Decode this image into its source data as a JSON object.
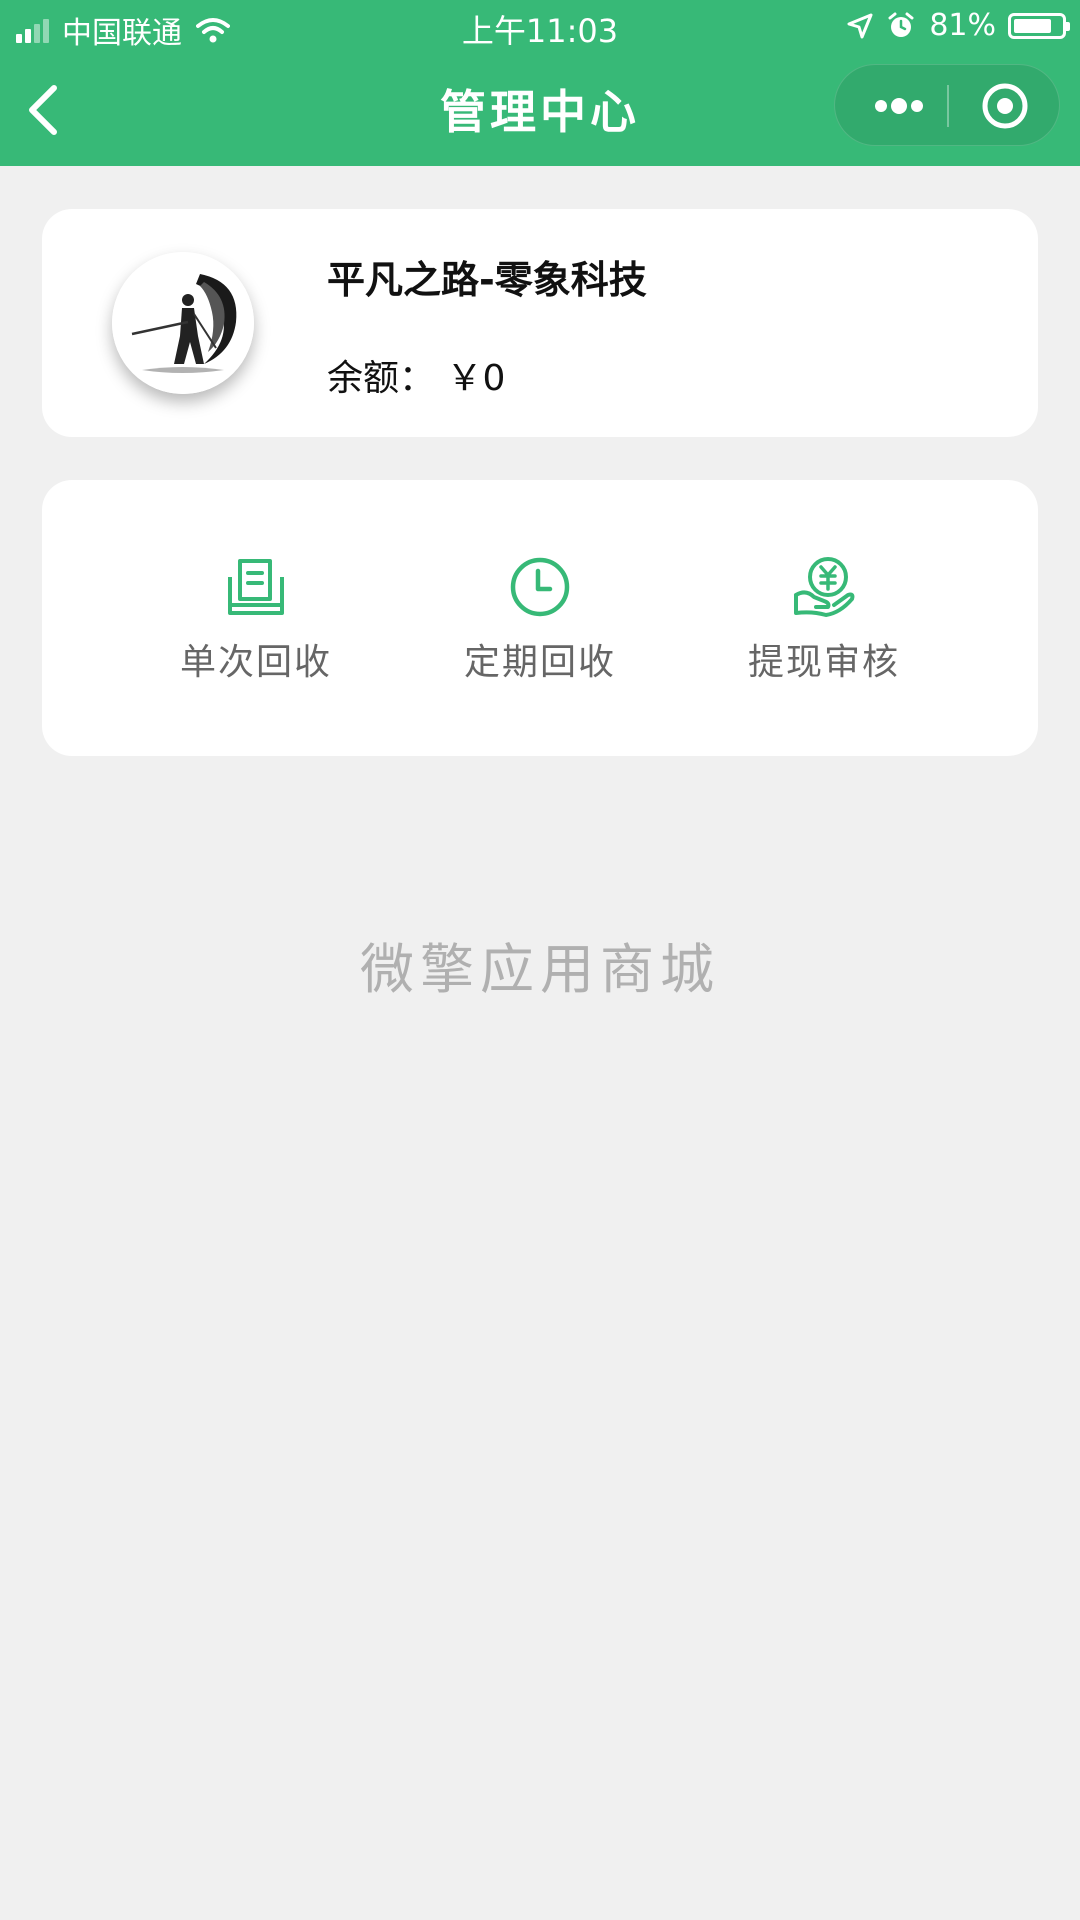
{
  "status_bar": {
    "carrier": "中国联通",
    "time": "上午11:03",
    "battery_text": "81%",
    "battery_level": 0.81
  },
  "nav": {
    "title": "管理中心"
  },
  "user": {
    "name": "平凡之路-零象科技",
    "balance_label": "余额：",
    "balance_value": "￥0"
  },
  "menu": [
    {
      "label": "单次回收",
      "icon": "book-stack-icon"
    },
    {
      "label": "定期回收",
      "icon": "clock-icon"
    },
    {
      "label": "提现审核",
      "icon": "hand-coin-icon"
    }
  ],
  "footer": {
    "brand": "微擎应用商城"
  },
  "colors": {
    "primary": "#37b977",
    "background": "#f0f0f0"
  }
}
